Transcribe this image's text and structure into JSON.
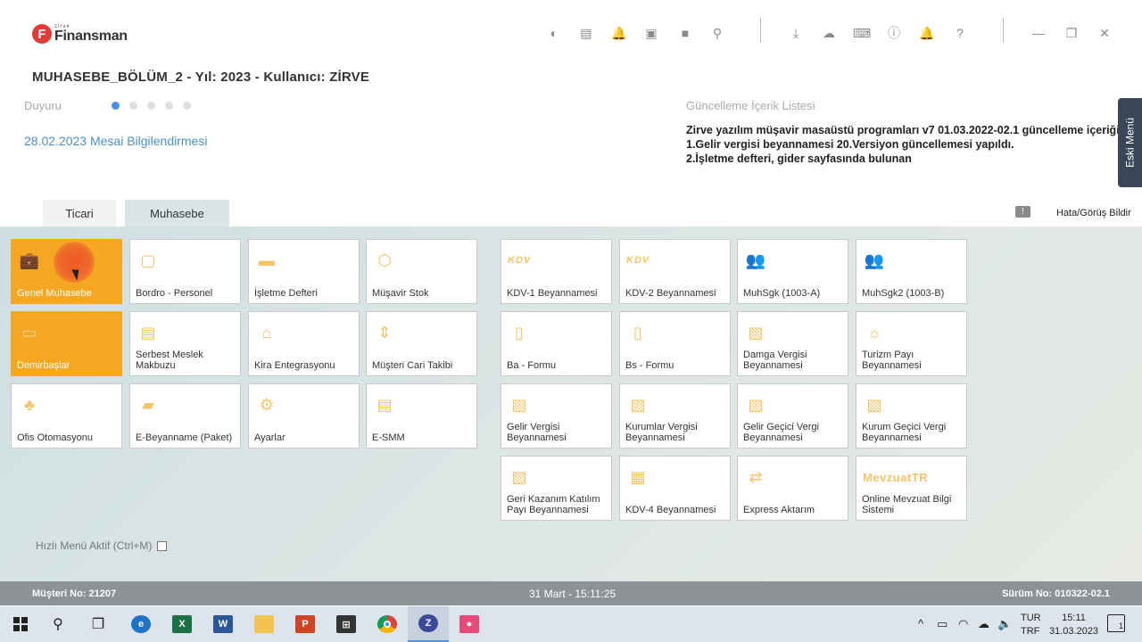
{
  "logo": {
    "small": "zirve",
    "name": "Finansman",
    "initial": "F"
  },
  "header_title": "MUHASEBE_BÖLÜM_2 - Yıl: 2023 - Kullanıcı: ZİRVE",
  "duyuru": {
    "label": "Duyuru",
    "dots": 5,
    "active_dot": 0,
    "link": "28.02.2023 Mesai Bilgilendirmesi"
  },
  "update": {
    "title": "Güncelleme İçerik Listesi",
    "lines": [
      "Zirve yazılım müşavir masaüstü programları v7 01.03.2022-02.1 güncelleme içeriği",
      "1.Gelir vergisi beyannamesi 20.Versiyon güncellemesi yapıldı.",
      "2.İşletme defteri, gider sayfasında bulunan"
    ]
  },
  "side_tab": "Eski Menü",
  "tabs": {
    "ticari": "Ticari",
    "muhasebe": "Muhasebe",
    "active": "muhasebe"
  },
  "report_bug": "Hata/Görüş Bildir",
  "tiles": [
    {
      "label": "Genel Muhasebe",
      "icon": "briefcase-icon",
      "active": true
    },
    {
      "label": "Bordro - Personel",
      "icon": "id-card-icon"
    },
    {
      "label": "İşletme Defteri",
      "icon": "book-icon"
    },
    {
      "label": "Müşavir Stok",
      "icon": "box-icon"
    },
    {
      "label": "Demirbaşlar",
      "icon": "archive-icon",
      "active": true
    },
    {
      "label": "Serbest Meslek Makbuzu",
      "icon": "receipt-icon"
    },
    {
      "label": "Kira Entegrasyonu",
      "icon": "house-icon"
    },
    {
      "label": "Müşteri Cari Takibi",
      "icon": "sort-icon"
    },
    {
      "label": "Ofis Otomasyonu",
      "icon": "org-chart-icon"
    },
    {
      "label": "E-Beyanname (Paket)",
      "icon": "folder-doc-icon"
    },
    {
      "label": "Ayarlar",
      "icon": "gear-icon"
    },
    {
      "label": "E-SMM",
      "icon": "receipt-icon"
    },
    {
      "label": "KDV-1 Beyannamesi",
      "icon": "kdv-icon",
      "word": "KDV"
    },
    {
      "label": "KDV-2 Beyannamesi",
      "icon": "kdv-icon",
      "word": "KDV"
    },
    {
      "label": "MuhSgk (1003-A)",
      "icon": "users-icon"
    },
    {
      "label": "MuhSgk2 (1003-B)",
      "icon": "users-icon"
    },
    {
      "label": "Ba - Formu",
      "icon": "ba-doc-icon"
    },
    {
      "label": "Bs - Formu",
      "icon": "bs-doc-icon"
    },
    {
      "label": "Damga Vergisi Beyannamesi",
      "icon": "doc-upload-icon"
    },
    {
      "label": "Turizm Payı Beyannamesi",
      "icon": "sun-icon"
    },
    {
      "label": "Gelir Vergisi Beyannamesi",
      "icon": "doc-upload-icon"
    },
    {
      "label": "Kurumlar Vergisi Beyannamesi",
      "icon": "doc-upload-icon"
    },
    {
      "label": "Gelir Geçici Vergi Beyannamesi",
      "icon": "doc-upload-icon"
    },
    {
      "label": "Kurum Geçici Vergi Beyannamesi",
      "icon": "doc-upload-icon"
    },
    {
      "label": "Geri Kazanım Katılım Payı Beyannamesi",
      "icon": "doc-upload-icon"
    },
    {
      "label": "KDV-4 Beyannamesi",
      "icon": "grid-doc-icon"
    },
    {
      "label": "Express Aktarım",
      "icon": "transfer-arrows-icon"
    },
    {
      "label": "Online Mevzuat Bilgi Sistemi",
      "icon": "mevzuat-logo-icon",
      "word": "MevzuatTR"
    }
  ],
  "quick_menu": "Hızlı Menü Aktif (Ctrl+M)",
  "footer": {
    "customer": "Müşteri No: 21207",
    "datetime": "31 Mart - 15:11:25",
    "version": "Sürüm No: 010322-02.1"
  },
  "taskbar": {
    "lang_top": "TUR",
    "lang_bottom": "TRF",
    "time": "15:11",
    "date": "31.03.2023",
    "notifications": "1"
  },
  "colors": {
    "accent": "#f6a722",
    "icon": "#f4c466",
    "link": "#4a90c8",
    "footer": "#8c9296",
    "side_tab": "#3a4656"
  }
}
